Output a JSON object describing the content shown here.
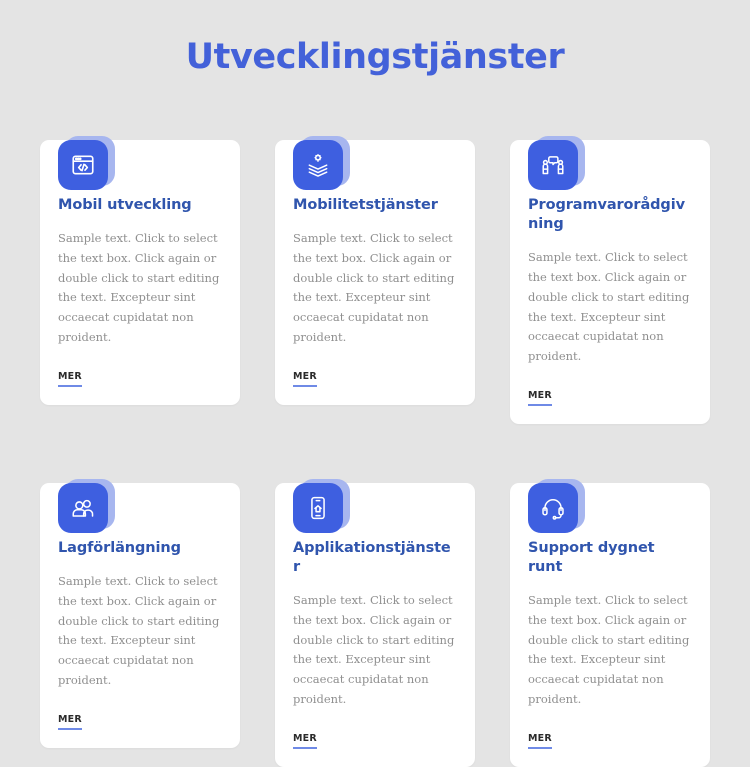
{
  "page": {
    "title": "Utvecklingstjänster",
    "background_color": "#e4e4e4",
    "accent_color": "#3e5fe0",
    "title_color": "#4361d9",
    "card_title_color": "#3055ad",
    "body_text_color": "#8f8f8f",
    "icon_shadow_color": "#a7b6ef"
  },
  "cards": [
    {
      "icon": "code-window-icon",
      "title": "Mobil utveckling",
      "text": "Sample text. Click to select the text box. Click again or double click to start editing the text. Excepteur sint occaecat cupidatat non proident.",
      "link_label": "MER"
    },
    {
      "icon": "layers-gear-icon",
      "title": "Mobilitetstjänster",
      "text": "Sample text. Click to select the text box. Click again or double click to start editing the text. Excepteur sint occaecat cupidatat non proident.",
      "link_label": "MER"
    },
    {
      "icon": "people-consulting-icon",
      "title": "Programvarorådgivning",
      "text": "Sample text. Click to select the text box. Click again or double click to start editing the text. Excepteur sint occaecat cupidatat non proident.",
      "link_label": "MER"
    },
    {
      "icon": "user-group-icon",
      "title": "Lagförlängning",
      "text": "Sample text. Click to select the text box. Click again or double click to start editing the text. Excepteur sint occaecat cupidatat non proident.",
      "link_label": "MER"
    },
    {
      "icon": "mobile-app-icon",
      "title": "Applikationstjänster",
      "text": "Sample text. Click to select the text box. Click again or double click to start editing the text. Excepteur sint occaecat cupidatat non proident.",
      "link_label": "MER"
    },
    {
      "icon": "headset-icon",
      "title": "Support dygnet runt",
      "text": "Sample text. Click to select the text box. Click again or double click to start editing the text. Excepteur sint occaecat cupidatat non proident.",
      "link_label": "MER"
    }
  ]
}
